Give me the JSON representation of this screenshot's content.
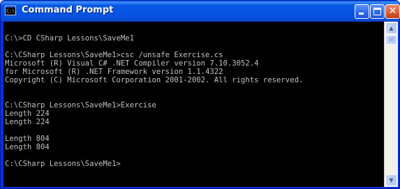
{
  "window": {
    "title": "Command Prompt",
    "icon": "C:\\"
  },
  "controls": {
    "minimize": "minimize",
    "maximize": "maximize",
    "close": "close"
  },
  "console": {
    "lines": [
      "",
      "C:\\>CD CSharp Lessons\\SaveMe1",
      "",
      "C:\\CSharp Lessons\\SaveMe1>csc /unsafe Exercise.cs",
      "Microsoft (R) Visual C# .NET Compiler version 7.10.3052.4",
      "for Microsoft (R) .NET Framework version 1.1.4322",
      "Copyright (C) Microsoft Corporation 2001-2002. All rights reserved.",
      "",
      "",
      "C:\\CSharp Lessons\\SaveMe1>Exercise",
      "Length 224",
      "Length 224",
      "",
      "Length 804",
      "Length 804",
      "",
      "C:\\CSharp Lessons\\SaveMe1>"
    ]
  },
  "scrollbar": {
    "up_arrow": "▲",
    "down_arrow": "▼"
  }
}
